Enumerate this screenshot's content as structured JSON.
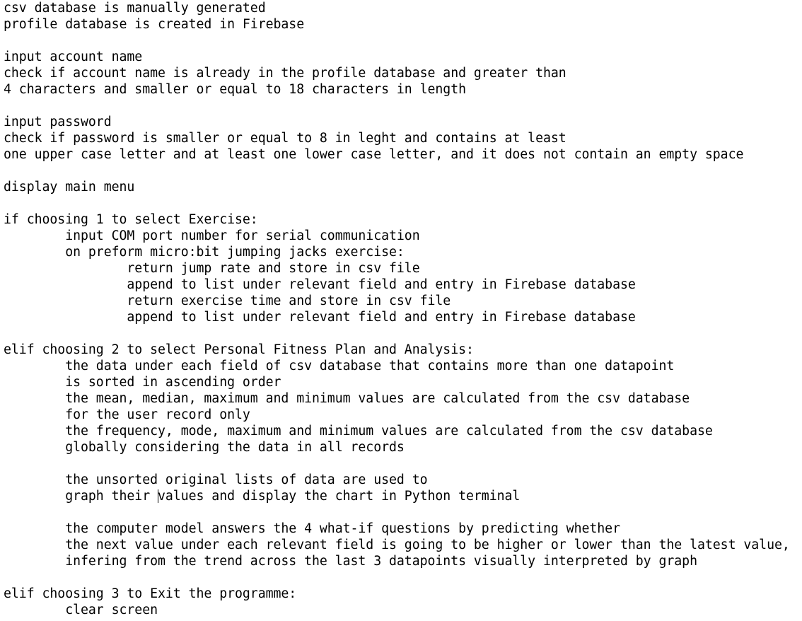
{
  "document": {
    "lines": [
      "csv database is manually generated",
      "profile database is created in Firebase",
      "",
      "input account name",
      "check if account name is already in the profile database and greater than",
      "4 characters and smaller or equal to 18 characters in length",
      "",
      "input password",
      "check if password is smaller or equal to 8 in leght and contains at least",
      "one upper case letter and at least one lower case letter, and it does not contain an empty space",
      "",
      "display main menu",
      "",
      "if choosing 1 to select Exercise:",
      "        input COM port number for serial communication",
      "        on preform micro:bit jumping jacks exercise:",
      "                return jump rate and store in csv file",
      "                append to list under relevant field and entry in Firebase database",
      "                return exercise time and store in csv file",
      "                append to list under relevant field and entry in Firebase database",
      "",
      "elif choosing 2 to select Personal Fitness Plan and Analysis:",
      "        the data under each field of csv database that contains more than one datapoint",
      "        is sorted in ascending order",
      "        the mean, median, maximum and minimum values are calculated from the csv database",
      "        for the user record only",
      "        the frequency, mode, maximum and minimum values are calculated from the csv database",
      "        globally considering the data in all records",
      "",
      "        the unsorted original lists of data are used to",
      "        graph their values and display the chart in Python terminal",
      "",
      "        the computer model answers the 4 what-if questions by predicting whether",
      "        the next value under each relevant field is going to be higher or lower than the latest value,",
      "        infering from the trend across the last 3 datapoints visually interpreted by graph",
      "",
      "elif choosing 3 to Exit the programme:",
      "        clear screen"
    ],
    "caret_line_index": 30,
    "caret_after_text": "        graph their "
  }
}
